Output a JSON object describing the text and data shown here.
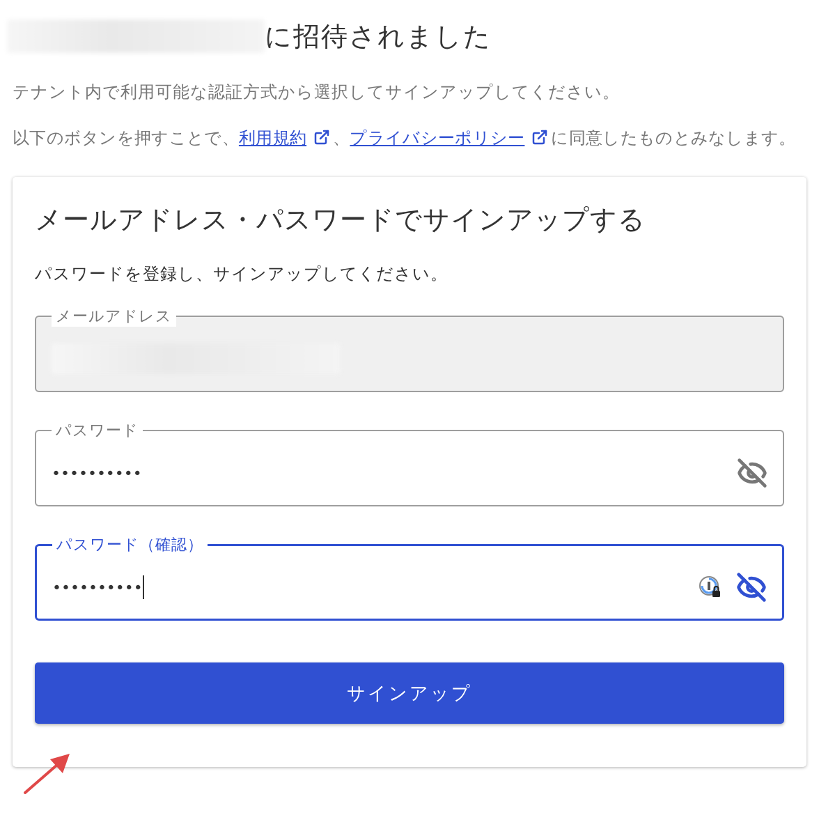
{
  "header": {
    "redacted_prefix": true,
    "title": "に招待されました"
  },
  "intro": "テナント内で利用可能な認証方式から選択してサインアップしてください。",
  "consent": [
    {
      "kind": "text",
      "text": "以下のボタンを押すことで、"
    },
    {
      "kind": "link",
      "text": "利用規約"
    },
    {
      "kind": "text",
      "text": "、"
    },
    {
      "kind": "link",
      "text": "プライバシーポリシー"
    },
    {
      "kind": "text",
      "text": "に同意したものとみなします。"
    }
  ],
  "card": {
    "title": "メールアドレス・パスワードでサインアップする",
    "instruction": "パスワードを登録し、サインアップしてください。",
    "fields": [
      {
        "label": "メールアドレス",
        "kind": "email",
        "redacted": true,
        "disabled": true,
        "focused": false
      },
      {
        "label": "パスワード",
        "kind": "password",
        "value": "••••••••••",
        "disabled": false,
        "focused": false
      },
      {
        "label": "パスワード（確認）",
        "kind": "password",
        "value": "••••••••••",
        "disabled": false,
        "focused": true
      }
    ],
    "button": "サインアップ"
  }
}
